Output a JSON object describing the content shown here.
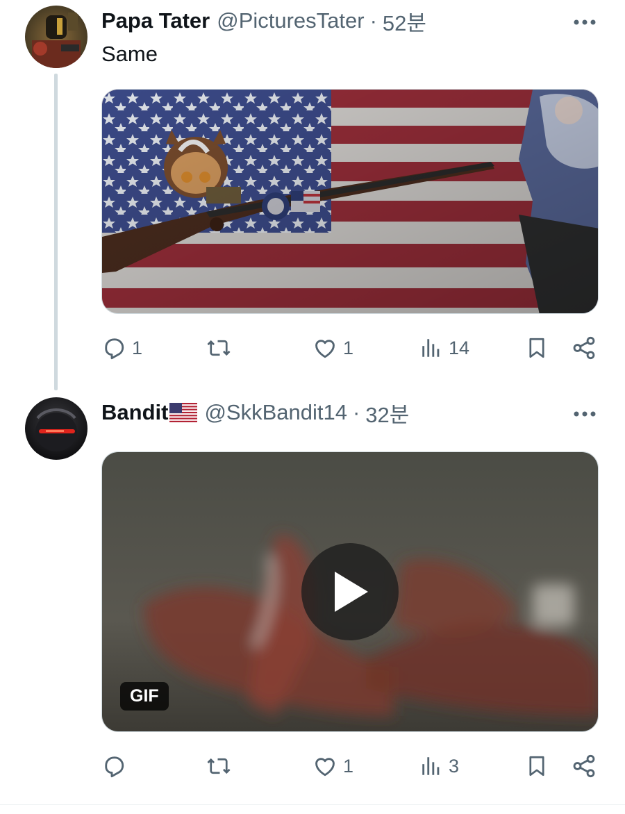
{
  "tweets": [
    {
      "display_name": "Papa Tater",
      "handle": "@PicturesTater",
      "separator": "·",
      "time": "52분",
      "text": "Same",
      "stats": {
        "replies": "1",
        "reposts": "",
        "likes": "1",
        "views": "14"
      }
    },
    {
      "display_name": "Bandit",
      "flag": "us-flag-emoji",
      "handle": "@SkkBandit14",
      "separator": "·",
      "time": "32분",
      "media_badge": "GIF",
      "stats": {
        "replies": "",
        "reposts": "",
        "likes": "1",
        "views": "3"
      }
    }
  ],
  "colors": {
    "text": "#0f1419",
    "secondary": "#536471",
    "thread_line": "#cfd9de"
  },
  "icons": [
    "more-icon",
    "reply-icon",
    "repost-icon",
    "like-icon",
    "views-icon",
    "bookmark-icon",
    "share-icon",
    "play-icon"
  ]
}
